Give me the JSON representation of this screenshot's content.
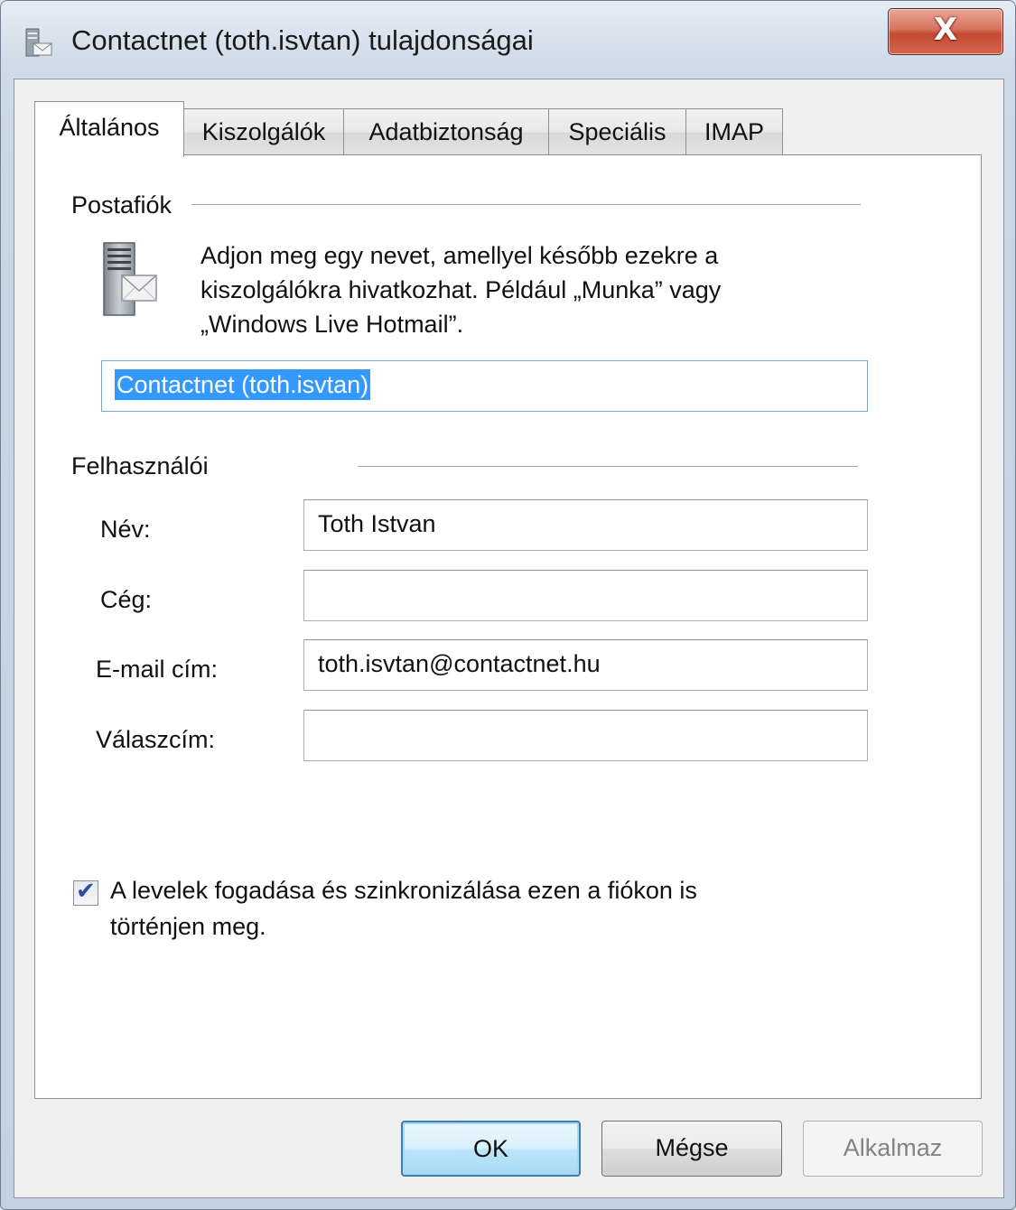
{
  "window": {
    "title": "Contactnet (toth.isvtan) tulajdonságai",
    "close_label": "X"
  },
  "tabs": [
    {
      "label": "Általános",
      "active": true
    },
    {
      "label": "Kiszolgálók",
      "active": false
    },
    {
      "label": "Adatbiztonság",
      "active": false
    },
    {
      "label": "Speciális",
      "active": false
    },
    {
      "label": "IMAP",
      "active": false
    }
  ],
  "mail_account": {
    "group_label": "Postafiók",
    "description": "Adjon meg egy nevet, amellyel később ezekre a kiszolgálókra hivatkozhat. Például „Munka” vagy „Windows Live Hotmail”.",
    "account_name": "Contactnet (toth.isvtan)"
  },
  "user_info": {
    "group_label": "Felhasználói",
    "name_label": "Név:",
    "name_value": "Toth Istvan",
    "company_label": "Cég:",
    "company_value": "",
    "email_label": "E-mail cím:",
    "email_value": "toth.isvtan@contactnet.hu",
    "reply_label": "Válaszcím:",
    "reply_value": ""
  },
  "sync": {
    "checked": true,
    "label": "A levelek fogadása és szinkronizálása ezen a fiókon is történjen meg."
  },
  "buttons": {
    "ok": "OK",
    "cancel": "Mégse",
    "apply": "Alkalmaz"
  }
}
